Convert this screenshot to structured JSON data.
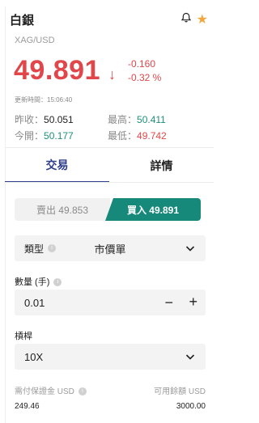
{
  "header": {
    "title": "白銀",
    "symbol": "XAG/USD"
  },
  "quote": {
    "price": "49.891",
    "change": "-0.160",
    "change_pct": "-0.32 %",
    "updated": "更新時間：15:06:40"
  },
  "stats": {
    "prev_close_label": "昨收：",
    "prev_close": "50.051",
    "high_label": "最高：",
    "high": "50.411",
    "open_label": "今開：",
    "open": "50.177",
    "low_label": "最低：",
    "low": "49.742"
  },
  "tabs": [
    {
      "label": "交易"
    },
    {
      "label": "詳情"
    }
  ],
  "trade": {
    "sell_label": "賣出 49.853",
    "buy_label": "買入 49.891",
    "type_label": "類型",
    "type_value": "市價單",
    "qty_label": "數量 (手)",
    "qty_value": "0.01",
    "leverage_label": "槓桿",
    "leverage_value": "10X",
    "margin_label": "需付保證金 USD",
    "margin_value": "249.46",
    "available_label": "可用餘額 USD",
    "available_value": "3000.00"
  },
  "icons": {
    "bell": "bell-icon",
    "star": "star-icon",
    "info": "info-icon",
    "chevron": "chevron-down-icon"
  },
  "colors": {
    "red": "#e0464a",
    "green": "#1f8f7a",
    "buy_button": "#17897a",
    "tab_active": "#2f3e8b",
    "star": "#f2a63b"
  }
}
